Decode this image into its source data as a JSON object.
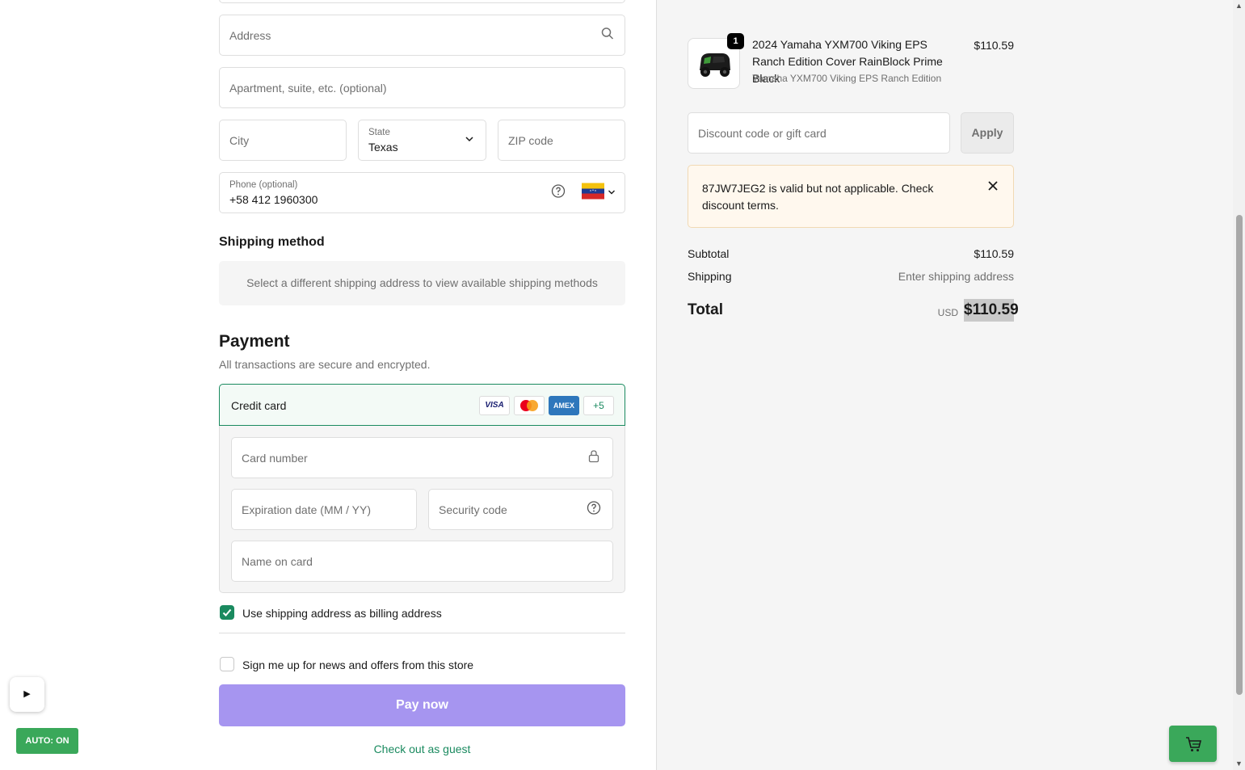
{
  "shipping_form": {
    "address_placeholder": "Address",
    "apartment_placeholder": "Apartment, suite, etc. (optional)",
    "city_placeholder": "City",
    "state_label": "State",
    "state_value": "Texas",
    "zip_placeholder": "ZIP code",
    "phone_label": "Phone (optional)",
    "phone_value": "+58 412 1960300",
    "phone_country": "Venezuela"
  },
  "shipping_method": {
    "heading": "Shipping method",
    "message": "Select a different shipping address to view available shipping methods"
  },
  "payment": {
    "heading": "Payment",
    "subtitle": "All transactions are secure and encrypted.",
    "method_label": "Credit card",
    "card_logos": [
      "VISA",
      "Mastercard",
      "AMEX",
      "+5"
    ],
    "card_number_placeholder": "Card number",
    "expiration_placeholder": "Expiration date (MM / YY)",
    "security_code_placeholder": "Security code",
    "name_on_card_placeholder": "Name on card",
    "billing_same_label": "Use shipping address as billing address",
    "billing_same_checked": true,
    "newsletter_label": "Sign me up for news and offers from this store",
    "newsletter_checked": false,
    "pay_button": "Pay now",
    "guest_link": "Check out as guest"
  },
  "overlay": {
    "play_label": "▶",
    "auto_label": "AUTO: ON"
  },
  "order_summary": {
    "item": {
      "quantity": "1",
      "name": "2024 Yamaha YXM700 Viking EPS Ranch Edition Cover RainBlock Prime Black",
      "variant": "Yamaha YXM700 Viking EPS Ranch Edition",
      "price": "$110.59"
    },
    "discount_placeholder": "Discount code or gift card",
    "apply_button": "Apply",
    "notice": "87JW7JEG2 is valid but not applicable. Check discount terms.",
    "subtotal_label": "Subtotal",
    "subtotal_value": "$110.59",
    "shipping_label": "Shipping",
    "shipping_value": "Enter shipping address",
    "total_label": "Total",
    "total_currency": "USD",
    "total_value": "$110.59"
  },
  "colors": {
    "accent_green": "#1a8a5f",
    "pay_button": "#a695f0",
    "notice_bg": "#fff8ee",
    "auto_badge": "#3aa85a"
  }
}
